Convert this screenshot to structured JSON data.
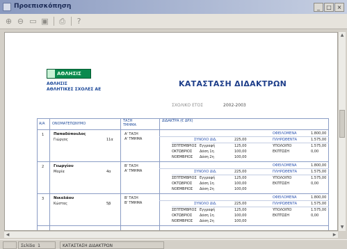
{
  "window": {
    "title": "Προεπισκόπηση",
    "controls": [
      "_",
      "□",
      "×"
    ]
  },
  "toolbar": {
    "icons": [
      "zoom-in-icon",
      "zoom-out-icon",
      "page-icon",
      "two-pages-icon",
      "print-icon",
      "help-icon"
    ],
    "glyphs": [
      "⊕",
      "⊖",
      "▭",
      "▣",
      "⎙",
      "?"
    ]
  },
  "report": {
    "logo_text": "ΑΘΛΗΣΙΣ",
    "company_line1": "ΑΘΛΗΣΙΣ",
    "company_line2": "ΑΘΛΗΤΙΚΕΣ ΣΧΟΛΕΣ ΑΕ",
    "title": "ΚΑΤΑΣΤΑΣΗ ΔΙΔΑΚΤΡΩΝ",
    "period_label": "ΣΧΟΛΙΚΟ ΕΤΟΣ",
    "period_value": "2002-2003",
    "columns": [
      "Α/Α",
      "ΟΝΟΜΑΤΕΠΩΝΥΜΟ",
      "ΤΑΞΗ\nΤΜΗΜΑ",
      "ΔΙΔΑΚΤΡΑ (€ ΔΡΧ)"
    ],
    "rows": [
      {
        "num": "1",
        "name": "Παπαδόπουλος",
        "first": "Γιώργος",
        "code": "11α",
        "class1": "Α' ΤΑΞΗ",
        "class2": "Α' ΤΜΗΜΑ",
        "summary": [
          "ΟΦΕΙΛΟΜΕΝΑ",
          "1.800,00"
        ],
        "sub": [
          "ΣΥΝΟΛΟ ΔΙΔ.",
          "225,00",
          "ΠΛΗΡΩΘΕΝΤΑ",
          "1.575,00"
        ],
        "lines": [
          [
            "ΣΕΠΤΕΜΒΡΙΟΣ",
            "Εγγραφή",
            "125,00",
            "ΥΠΟΛΟΙΠΟ",
            "1.575,00"
          ],
          [
            "ΟΚΤΩΒΡΙΟΣ",
            "Δόση 1η",
            "100,00",
            "ΕΚΠΤΩΣΗ",
            "0,00"
          ],
          [
            "ΝΟΕΜΒΡΙΟΣ",
            "Δόση 2η",
            "100,00",
            "",
            ""
          ]
        ]
      },
      {
        "num": "2",
        "name": "Γεωργίου",
        "first": "Μαρία",
        "code": "4α",
        "class1": "Β' ΤΑΞΗ",
        "class2": "Α' ΤΜΗΜΑ",
        "summary": [
          "ΟΦΕΙΛΟΜΕΝΑ",
          "1.800,00"
        ],
        "sub": [
          "ΣΥΝΟΛΟ ΔΙΔ.",
          "225,00",
          "ΠΛΗΡΩΘΕΝΤΑ",
          "1.575,00"
        ],
        "lines": [
          [
            "ΣΕΠΤΕΜΒΡΙΟΣ",
            "Εγγραφή",
            "125,00",
            "ΥΠΟΛΟΙΠΟ",
            "1.575,00"
          ],
          [
            "ΟΚΤΩΒΡΙΟΣ",
            "Δόση 1η",
            "100,00",
            "ΕΚΠΤΩΣΗ",
            "0,00"
          ],
          [
            "ΝΟΕΜΒΡΙΟΣ",
            "Δόση 2η",
            "100,00",
            "",
            ""
          ]
        ]
      },
      {
        "num": "3",
        "name": "Νικολάου",
        "first": "Κώστας",
        "code": "5β",
        "class1": "Β' ΤΑΞΗ",
        "class2": "Β' ΤΜΗΜΑ",
        "summary": [
          "ΟΦΕΙΛΟΜΕΝΑ",
          "1.800,00"
        ],
        "sub": [
          "ΣΥΝΟΛΟ ΔΙΔ.",
          "225,00",
          "ΠΛΗΡΩΘΕΝΤΑ",
          "1.575,00"
        ],
        "lines": [
          [
            "ΣΕΠΤΕΜΒΡΙΟΣ",
            "Εγγραφή",
            "125,00",
            "ΥΠΟΛΟΙΠΟ",
            "1.575,00"
          ],
          [
            "ΟΚΤΩΒΡΙΟΣ",
            "Δόση 1η",
            "100,00",
            "ΕΚΠΤΩΣΗ",
            "0,00"
          ],
          [
            "ΝΟΕΜΒΡΙΟΣ",
            "Δόση 2η",
            "100,00",
            "",
            ""
          ]
        ]
      }
    ]
  },
  "status": {
    "page_label": "Σελίδα",
    "page_value": "1",
    "report_name": "ΚΑΤΑΣΤΑΣΗ ΔΙΔΑΚΤΡΩΝ"
  },
  "colors": {
    "title_blue": "#1e3e8a",
    "logo_green": "#0a8a4e",
    "grid": "#8a9cc4"
  }
}
